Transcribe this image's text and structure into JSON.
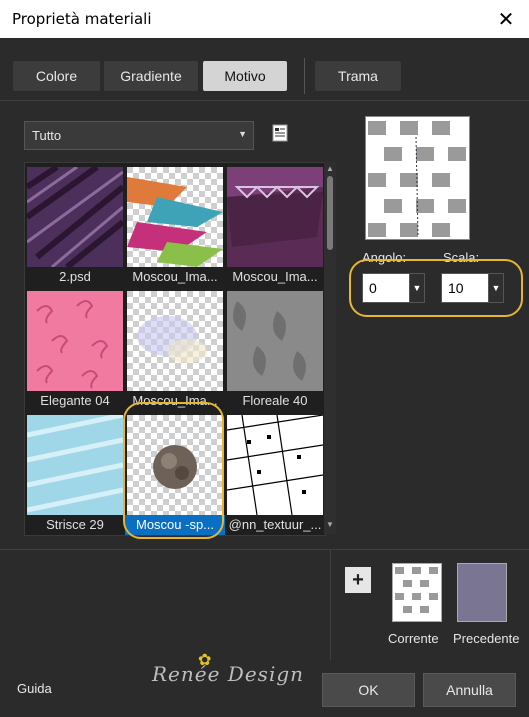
{
  "window": {
    "title": "Proprietà materiali",
    "close_glyph": "✕"
  },
  "tabs": [
    "Colore",
    "Gradiente",
    "Motivo",
    "Trama"
  ],
  "category": {
    "value": "Tutto"
  },
  "thumbnails": [
    "2.psd",
    "Moscou_Ima...",
    "Moscou_Ima...",
    "Elegante 04",
    "Moscou_Ima...",
    "Floreale 40",
    "Strisce 29",
    "Moscou -sp...",
    "@nn_textuur_..."
  ],
  "angle": {
    "label": "Angolo:",
    "value": "0"
  },
  "scale": {
    "label": "Scala:",
    "value": "10"
  },
  "current": {
    "label": "Corrente"
  },
  "previous": {
    "label": "Precedente",
    "color": "#7a7592"
  },
  "buttons": {
    "help": "Guida",
    "ok": "OK",
    "cancel": "Annulla"
  },
  "watermark": {
    "text": "Renée Design"
  },
  "colors": {
    "highlight_ring": "#e5b534",
    "selection": "#0a6fc2"
  }
}
